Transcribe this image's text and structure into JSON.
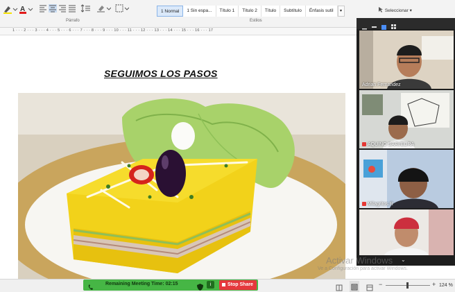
{
  "ribbon": {
    "styles": [
      "1 Normal",
      "1 Sin espa...",
      "Título 1",
      "Título 2",
      "Título",
      "Subtítulo",
      "Énfasis sutil"
    ],
    "group_paragraph": "Párrafo",
    "group_styles": "Estilos",
    "select_label": "Seleccionar"
  },
  "ruler": {
    "numbers": "1 · · · 2 · · · 3 · · · 4 · · · 5 · · · 6 · · · 7 · · · 8 · · · 9 · · · 10 · · · 11 · · · 12 · · · 13 · · · 14 · · · 15 · · · 16 · · · 17"
  },
  "document": {
    "title": "SEGUIMOS LOS PASOS"
  },
  "participants": [
    {
      "name": "Adrian Fernandez",
      "muted": false
    },
    {
      "name": "AQUINO SAAVEDRA",
      "muted": true
    },
    {
      "name": "Milagritos R",
      "muted": true
    },
    {
      "name": "",
      "muted": false
    }
  ],
  "meeting": {
    "remaining_label": "Remaining Meeting Time: 02:15",
    "stop_share_label": "Stop Share"
  },
  "statusbar": {
    "zoom": "124 %"
  },
  "watermark": {
    "title": "Activar Windows",
    "subtitle": "Ve a Configuración para activar Windows."
  },
  "colors": {
    "meeting_green": "#46b645",
    "stop_red": "#e5383d",
    "zoom_bg": "#1e1e1e",
    "plate_yellow": "#f4d31c"
  }
}
